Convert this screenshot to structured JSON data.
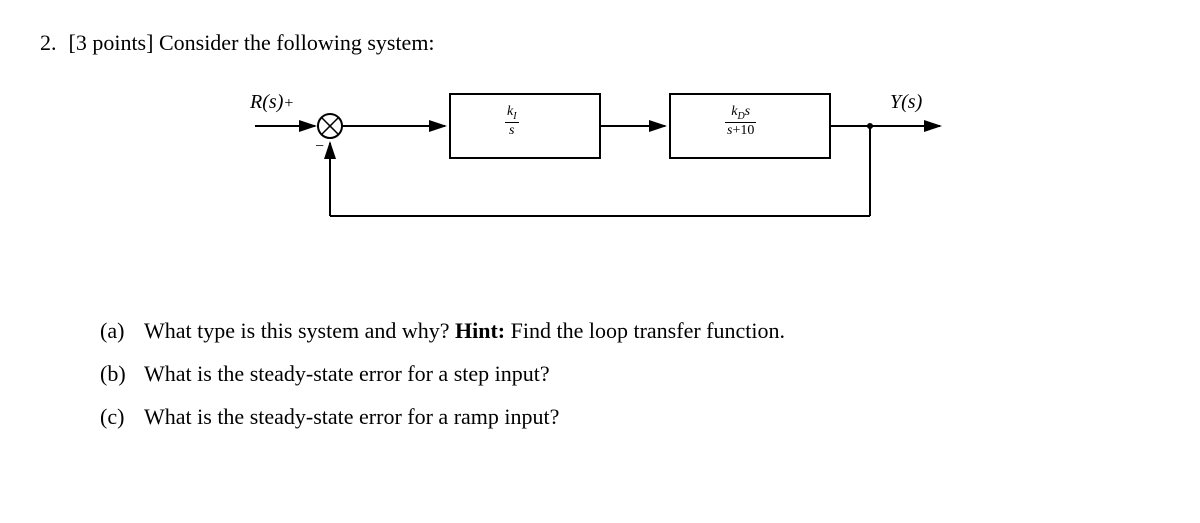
{
  "problem": {
    "number": "2.",
    "points": "[3 points]",
    "prompt": "Consider the following system:"
  },
  "diagram": {
    "input_label": "R(s)",
    "output_label": "Y(s)",
    "summing_plus": "+",
    "summing_minus": "−",
    "block1": {
      "numerator": "k_I",
      "denominator": "s"
    },
    "block2": {
      "numerator": "k_D s",
      "denominator": "s+10"
    }
  },
  "subparts": {
    "a": {
      "label": "(a)",
      "text": "What type is this system and why? ",
      "hint_label": "Hint:",
      "hint_text": " Find the loop transfer function."
    },
    "b": {
      "label": "(b)",
      "text": "What is the steady-state error for a step input?"
    },
    "c": {
      "label": "(c)",
      "text": "What is the steady-state error for a ramp input?"
    }
  }
}
